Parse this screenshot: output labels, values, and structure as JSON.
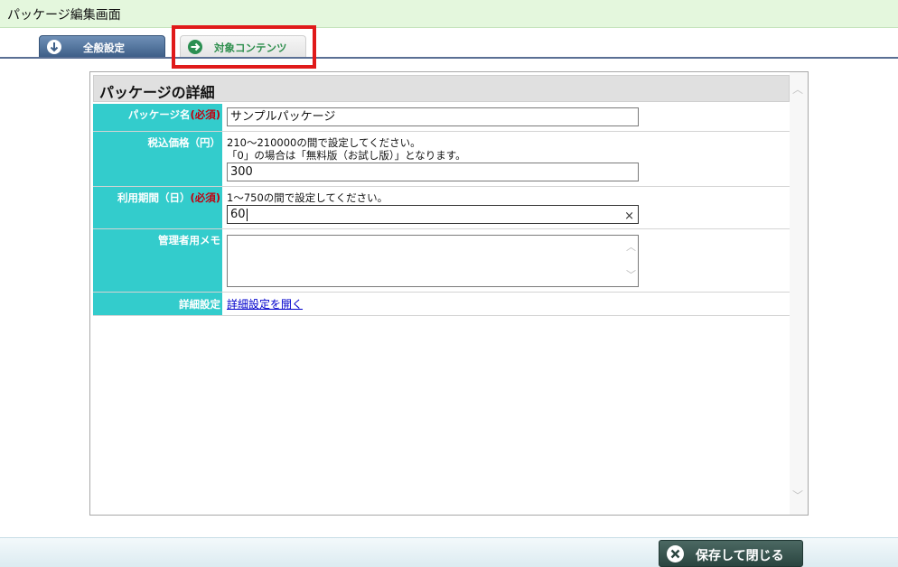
{
  "window": {
    "title": "パッケージ編集画面"
  },
  "tabs": {
    "general": {
      "label": "全般設定",
      "icon": "arrow-down-circle-icon"
    },
    "content": {
      "label": "対象コンテンツ",
      "icon": "arrow-right-circle-icon"
    }
  },
  "section": {
    "title": "パッケージの詳細"
  },
  "form": {
    "name": {
      "label": "パッケージ名",
      "required": "(必須)",
      "value": "サンプルパッケージ"
    },
    "price": {
      "label": "税込価格（円）",
      "help_line1": "210～210000の間で設定してください。",
      "help_line2": "「0」の場合は「無料版（お試し版）」となります。",
      "value": "300"
    },
    "period": {
      "label": "利用期間（日）",
      "required": "(必須)",
      "help": "1～750の間で設定してください。",
      "value": "60",
      "clear_glyph": "×"
    },
    "memo": {
      "label": "管理者用メモ",
      "value": ""
    },
    "detail": {
      "label": "詳細設定",
      "link": "詳細設定を開く"
    }
  },
  "footer": {
    "close_button": "保存して閉じる",
    "close_icon": "close-circle-icon"
  },
  "colors": {
    "label_bg": "#33cccc",
    "required": "#c0000f",
    "highlight": "#e01a1a",
    "tab_active": "#3e5f88",
    "content_tab_text": "#2f8f4e"
  }
}
